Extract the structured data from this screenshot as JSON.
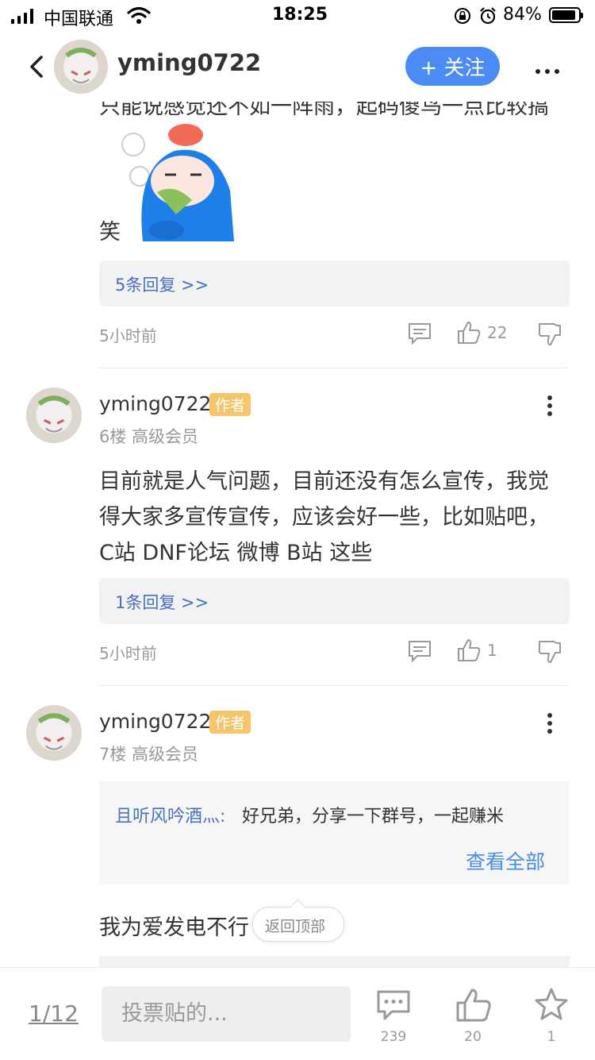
{
  "status": {
    "carrier": "中国联通",
    "time": "18:25",
    "battery": "84%"
  },
  "header": {
    "username": "yming0722",
    "follow_label": "+ 关注",
    "back_icon": "chevron-left-icon",
    "more_icon": "more-icon"
  },
  "top_comment": {
    "text_line1": "只能说感觉还不如一阵雨，起码傻鸟一点比较搞",
    "text_line2": "笑",
    "replies_link": "5条回复 >>",
    "time": "5小时前",
    "likes": "22"
  },
  "comments": [
    {
      "username": "yming0722",
      "badge": "作者",
      "floor": "6楼 高级会员",
      "text_lines": [
        "目前就是人气问题，目前还没有怎么宣传，我觉",
        "得大家多宣传宣传，应该会好一些，比如贴吧，",
        "C站  DNF论坛 微博 B站 这些"
      ],
      "replies_link": "1条回复 >>",
      "time": "5小时前",
      "likes": "1"
    },
    {
      "username": "yming0722",
      "badge": "作者",
      "floor": "7楼 高级会员",
      "quote_author": "且听风吟酒灬:",
      "quote_text": "好兄弟，分享一下群号，一起赚米",
      "view_all": "查看全部",
      "text": "我为爱发电不行"
    }
  ],
  "back_to_top": "返回顶部",
  "bottom": {
    "page": "1/12",
    "input_placeholder": "投票贴的...",
    "comment_count": "239",
    "like_count": "20",
    "star_count": "1"
  },
  "colors": {
    "accent": "#4b8bf5",
    "link": "#4a6fc1",
    "badge": "#f6c56b"
  }
}
